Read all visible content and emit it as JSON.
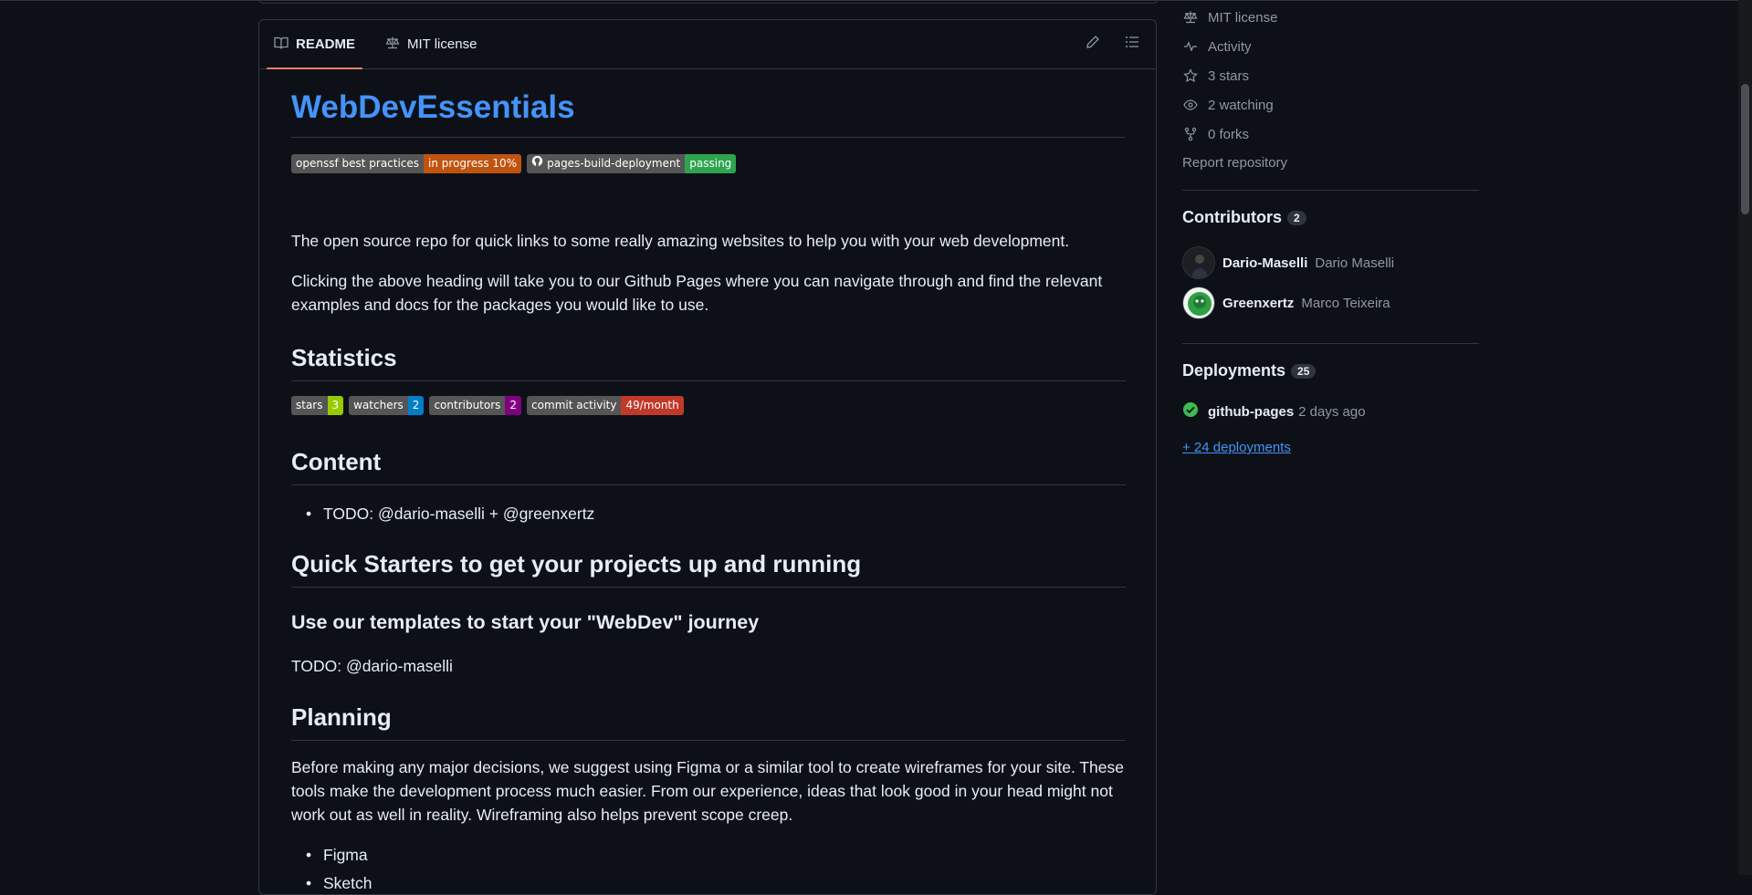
{
  "readme": {
    "tabs": [
      {
        "label": "README",
        "icon": "book-icon"
      },
      {
        "label": "MIT license",
        "icon": "scale-icon"
      }
    ],
    "title": "WebDevEssentials",
    "badges": [
      {
        "left": "openssf best practices",
        "right": "in progress 10%",
        "right_color": "#c0540f"
      },
      {
        "left": "pages-build-deployment",
        "right": "passing",
        "right_color": "#2ea44f"
      }
    ],
    "intro": "The open source repo for quick links to some really amazing websites to help you with your web development.",
    "intro2": "Clicking the above heading will take you to our Github Pages where you can navigate through and find the relevant examples and docs for the packages you would like to use.",
    "statistics_heading": "Statistics",
    "stat_badges": [
      {
        "left": "stars",
        "right": "3",
        "right_color": "#97ca00"
      },
      {
        "left": "watchers",
        "right": "2",
        "right_color": "#007ec6"
      },
      {
        "left": "contributors",
        "right": "2",
        "right_color": "#800080"
      },
      {
        "left": "commit activity",
        "right": "49/month",
        "right_color": "#c0392b"
      }
    ],
    "content_heading": "Content",
    "content_item": "TODO: @dario-maselli + @greenxertz",
    "quick_heading": "Quick Starters to get your projects up and running",
    "templates_heading": "Use our templates to start your \"WebDev\" journey",
    "templates_todo": "TODO: @dario-maselli",
    "planning_heading": "Planning",
    "planning_text": "Before making any major decisions, we suggest using Figma or a similar tool to create wireframes for your site. These tools make the development process much easier. From our experience, ideas that look good in your head might not work out as well in reality. Wireframing also helps prevent scope creep.",
    "planning_tools": [
      "Figma",
      "Sketch"
    ]
  },
  "sidebar": {
    "about_rows": [
      {
        "label": "MIT license",
        "icon": "scale-icon"
      },
      {
        "label": "Activity",
        "icon": "pulse-icon"
      },
      {
        "label": "3 stars",
        "icon": "star-icon"
      },
      {
        "label": "2 watching",
        "icon": "eye-icon"
      },
      {
        "label": "0 forks",
        "icon": "fork-icon"
      }
    ],
    "report": "Report repository",
    "contributors_heading": "Contributors",
    "contributors_count": "2",
    "contributors": [
      {
        "login": "Dario-Maselli",
        "name": "Dario Maselli"
      },
      {
        "login": "Greenxertz",
        "name": "Marco Teixeira"
      }
    ],
    "deployments_heading": "Deployments",
    "deployments_count": "25",
    "deployment": {
      "name": "github-pages",
      "time": "2 days ago"
    },
    "more_deployments": "+ 24 deployments"
  }
}
